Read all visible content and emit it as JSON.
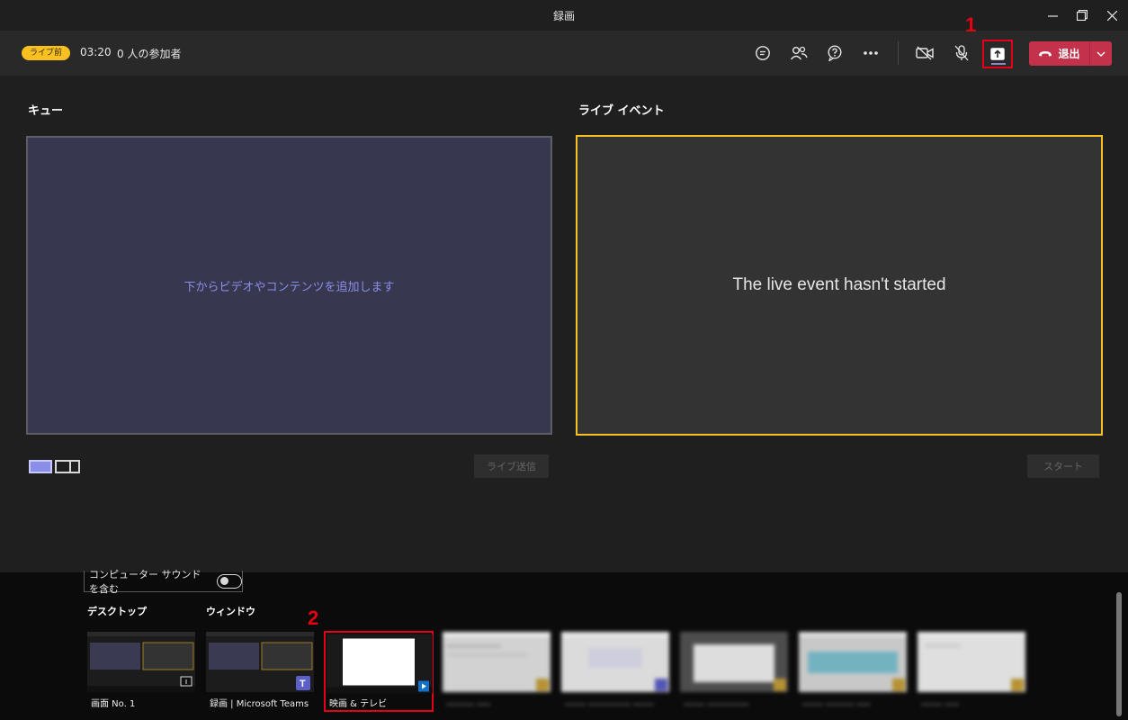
{
  "window": {
    "title": "録画"
  },
  "meeting_bar": {
    "badge": "ライブ前",
    "timer": "03:20",
    "participants": "0 人の参加者",
    "leave_label": "退出"
  },
  "markers": {
    "one": "1",
    "two": "2"
  },
  "stage": {
    "queue_title": "キュー",
    "queue_hint": "下からビデオやコンテンツを追加します",
    "live_title": "ライブ イベント",
    "live_message": "The live event hasn't started",
    "send_live_label": "ライブ送信",
    "start_label": "スタート"
  },
  "share_tray": {
    "include_sound_label": "コンピューター サウンドを含む",
    "desktop_heading": "デスクトップ",
    "window_heading": "ウィンドウ",
    "items": [
      {
        "caption": "画面 No. 1"
      },
      {
        "caption": "録画 | Microsoft Teams"
      },
      {
        "caption": "映画 & テレビ"
      }
    ]
  },
  "colors": {
    "accent_purple": "#8b8ee6",
    "live_border": "#f8c020",
    "leave_red": "#c4314b",
    "highlight_red": "#e3001b"
  }
}
